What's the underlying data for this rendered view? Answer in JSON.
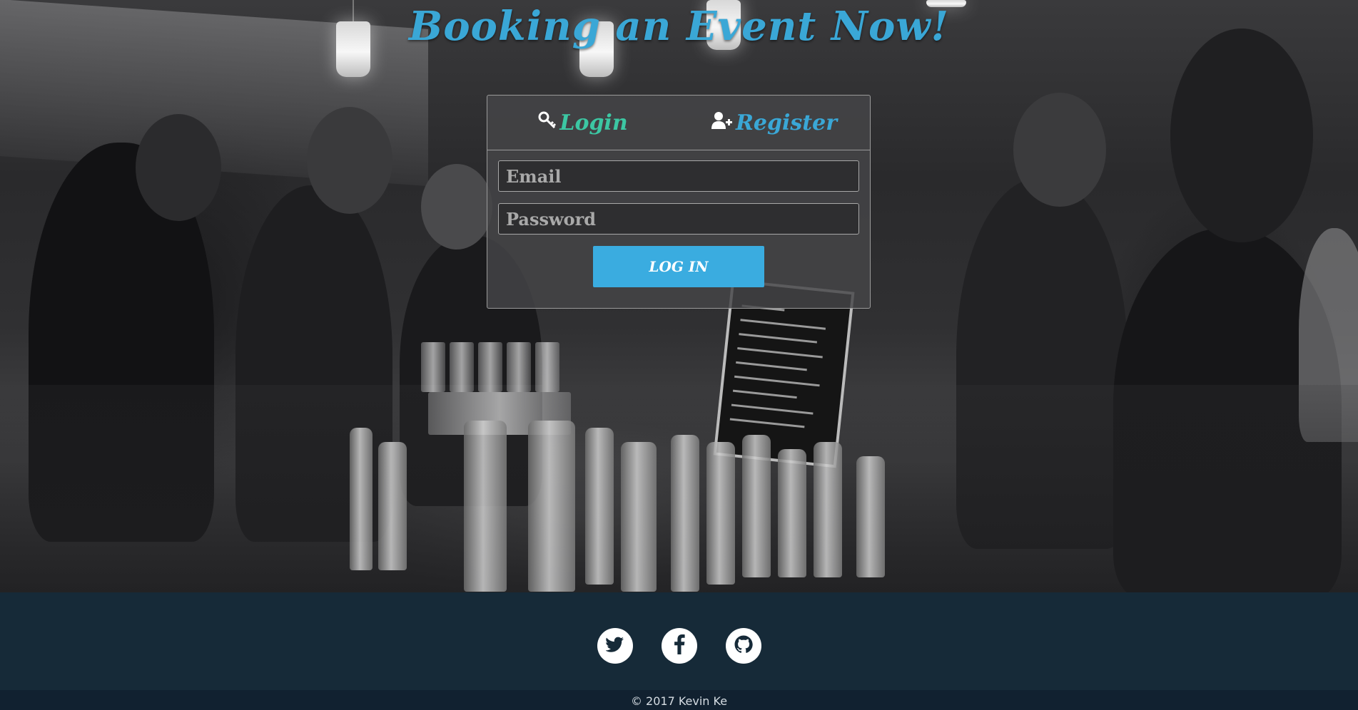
{
  "header": {
    "title": "Booking an Event Now!"
  },
  "auth_panel": {
    "tabs": [
      {
        "label": "Login",
        "icon": "key-icon",
        "color": "#3cc7a3"
      },
      {
        "label": "Register",
        "icon": "user-plus-icon",
        "color": "#3aa7d6"
      }
    ],
    "email_placeholder": "Email",
    "password_placeholder": "Password",
    "submit_label": "LOG IN"
  },
  "footer": {
    "social": [
      "twitter-icon",
      "facebook-icon",
      "github-icon"
    ],
    "copyright": "© 2017 Kevin Ke"
  },
  "colors": {
    "accent": "#3aa7d6",
    "login_tab": "#3cc7a3",
    "button": "#3aace0",
    "footer": "#162a38"
  }
}
